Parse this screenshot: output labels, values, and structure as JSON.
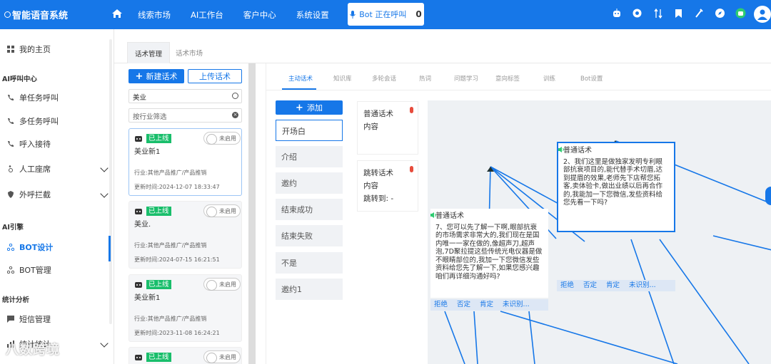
{
  "topbar": {
    "brand": "智能语音系统",
    "nav": [
      "线索市场",
      "AI工作台",
      "客户中心",
      "系统设置"
    ],
    "bot_status": "Bot 正在呼叫",
    "bot_count": "0",
    "colors": {
      "primary": "#1677e8"
    }
  },
  "sidebar": {
    "home": "我的主页",
    "group_ai_call": "AI呼叫中心",
    "single_call": "单任务呼叫",
    "multi_call": "多任务呼叫",
    "inbound": "呼入接待",
    "agent_seat": "人工座席",
    "outbound_block": "外呼拦截",
    "group_ai_engine": "AI引擎",
    "bot_design": "BOT设计",
    "bot_manage": "BOT管理",
    "group_stats": "统计分析",
    "sms_manage": "短信管理",
    "stats_partial": "统计统计"
  },
  "main_tabs": [
    "话术管理",
    "话术市场"
  ],
  "script_list": {
    "new_label": "新建话术",
    "upload_label": "上传话术",
    "search_value": "美业",
    "filter_placeholder": "按行业筛选",
    "cards": [
      {
        "badge": "已上线",
        "toggle": "未启用",
        "name": "美业新1",
        "industry": "行业:其他产品推广/产品推销",
        "updated": "更新时间:2024-12-07 18:33:47"
      },
      {
        "badge": "已上线",
        "toggle": "未启用",
        "name": "美业.",
        "industry": "行业:其他产品推广/产品推销",
        "updated": "更新时间:2024-07-15 16:21:51"
      },
      {
        "badge": "已上线",
        "toggle": "未启用",
        "name": "美业新1",
        "industry": "行业:其他产品推广/产品推销",
        "updated": "更新时间:2023-11-08 16:24:21"
      },
      {
        "badge": "已上线",
        "toggle": "未启用"
      }
    ]
  },
  "designer": {
    "tabs": [
      "主动话术",
      "知识库",
      "多轮会话",
      "热词",
      "问题学习",
      "意向标签",
      "训练",
      "Bot设置"
    ],
    "add_label": "添加",
    "nodes": [
      "开场白",
      "介绍",
      "邀约",
      "结束成功",
      "结束失败",
      "不是",
      "邀约1"
    ],
    "template_normal": {
      "title": "普通话术",
      "content": "内容"
    },
    "template_jump": {
      "title": "跳转话术",
      "content": "内容",
      "jump": "跳转到: -"
    },
    "flow_nodes": [
      {
        "title": "普通话术",
        "text": "2、我们这里是做独家发明专利眼部抗衰项目的,能代替手术切眉,达到提眉的效果,老师先下店帮您拓客,卖体验卡,做出业绩以后再合作的,我能加一下您微信,发些资料给您先看一下吗?",
        "branches": [
          "拒绝",
          "否定",
          "肯定",
          "未识别..."
        ]
      },
      {
        "title": "普通话术",
        "text": "7、您可以先了解一下啊,眼部抗衰的市场需求非常大的,我们现在是国内唯一一家在做的,像超声刀,超声泡,7D聚拉提这些传统光电仪器是做不眼睛部位的,我加一下您微信发些资料给您先了解一下,如果您感兴趣咱们再详细沟通好吗?",
        "branches": [
          "拒绝",
          "否定",
          "肯定",
          "未识别..."
        ]
      }
    ]
  },
  "watermark": "八数跨境"
}
